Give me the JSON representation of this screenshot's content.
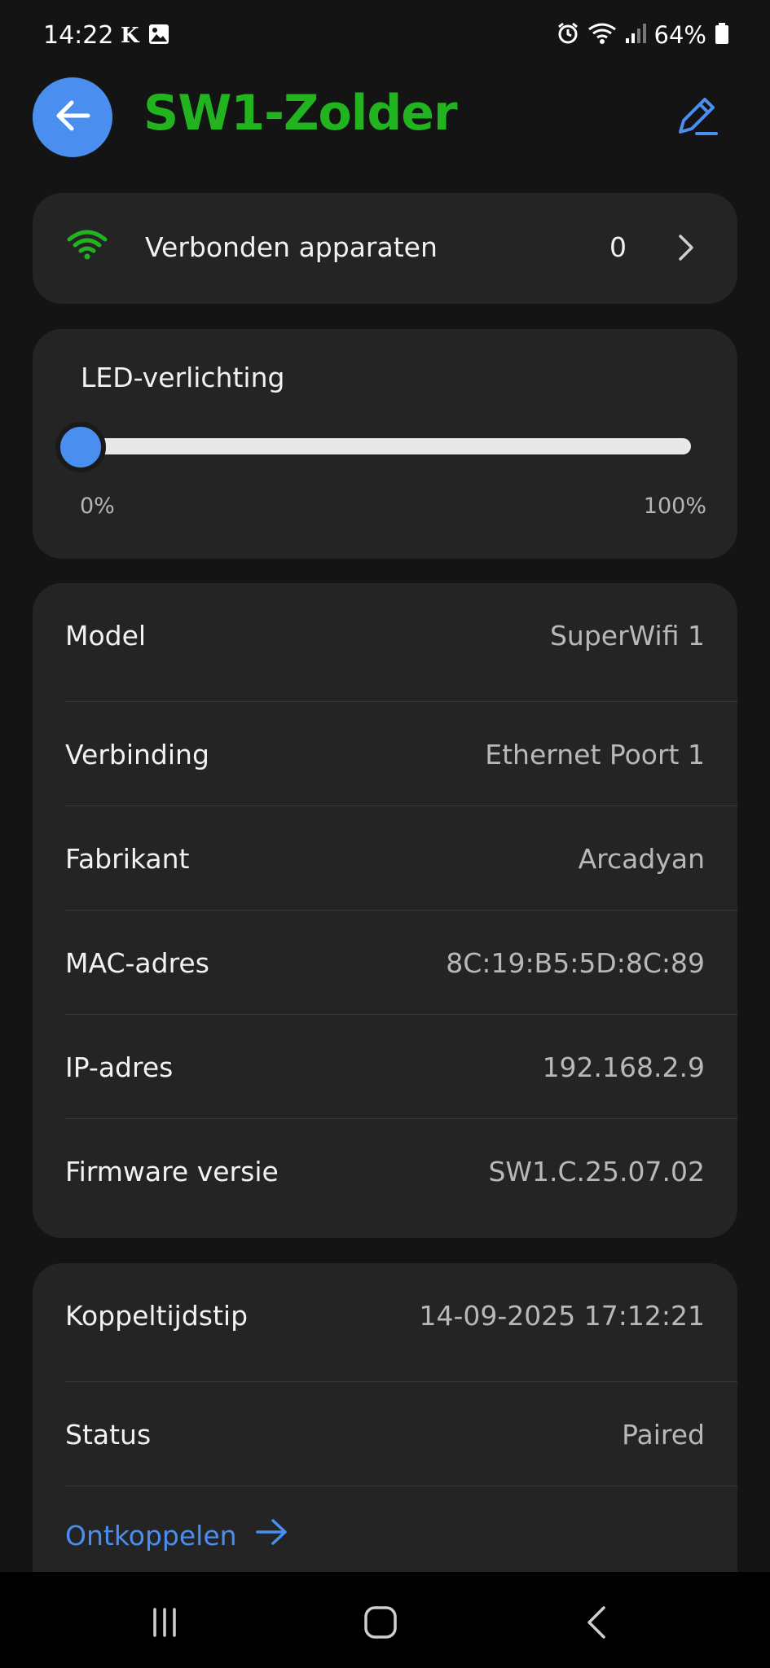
{
  "status_bar": {
    "time": "14:22",
    "left_icons": [
      "k-app-icon",
      "image-icon"
    ],
    "right_icons": [
      "alarm-icon",
      "wifi-icon",
      "signal-icon",
      "battery-icon"
    ],
    "battery": "64%"
  },
  "header": {
    "title": "SW1-Zolder",
    "title_color": "#21b41e",
    "back_icon": "arrow-left-icon",
    "edit_icon": "pencil-icon"
  },
  "devices": {
    "label": "Verbonden apparaten",
    "count": "0",
    "icon": "wifi-icon",
    "icon_color": "#21b41e"
  },
  "led": {
    "label": "LED-verlichting",
    "value_percent": 0,
    "min_label": "0%",
    "max_label": "100%"
  },
  "info": [
    {
      "label": "Model",
      "value": "SuperWifi 1"
    },
    {
      "label": "Verbinding",
      "value": "Ethernet Poort 1"
    },
    {
      "label": "Fabrikant",
      "value": "Arcadyan"
    },
    {
      "label": "MAC-adres",
      "value": "8C:19:B5:5D:8C:89"
    },
    {
      "label": "IP-adres",
      "value": "192.168.2.9"
    },
    {
      "label": "Firmware versie",
      "value": "SW1.C.25.07.02"
    }
  ],
  "pairing": [
    {
      "label": "Koppeltijdstip",
      "value": "14-09-2025 17:12:21"
    },
    {
      "label": "Status",
      "value": "Paired"
    }
  ],
  "unpair": {
    "label": "Ontkoppelen",
    "color": "#4a8ff0"
  },
  "nav": [
    "recent-apps-icon",
    "home-icon",
    "back-icon"
  ],
  "accent": "#4a8ff0"
}
